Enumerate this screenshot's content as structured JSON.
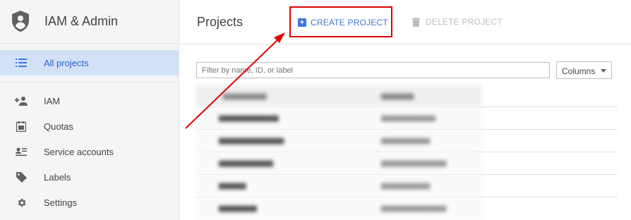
{
  "app": {
    "title": "IAM & Admin"
  },
  "sidebar": {
    "items": [
      {
        "label": "All projects",
        "icon": "list-icon",
        "active": true
      },
      {
        "label": "IAM",
        "icon": "add-person-icon"
      },
      {
        "label": "Quotas",
        "icon": "quota-icon"
      },
      {
        "label": "Service accounts",
        "icon": "service-account-icon"
      },
      {
        "label": "Labels",
        "icon": "label-tag-icon"
      },
      {
        "label": "Settings",
        "icon": "gear-icon"
      }
    ]
  },
  "main": {
    "title": "Projects",
    "create_label": "CREATE PROJECT",
    "delete_label": "DELETE PROJECT",
    "filter_placeholder": "Filter by name, ID, or label",
    "columns_label": "Columns"
  },
  "colors": {
    "accent": "#3a78d6",
    "highlight_box": "#e00000",
    "arrow": "#e00000",
    "active_nav_bg": "#d3e1f7"
  }
}
